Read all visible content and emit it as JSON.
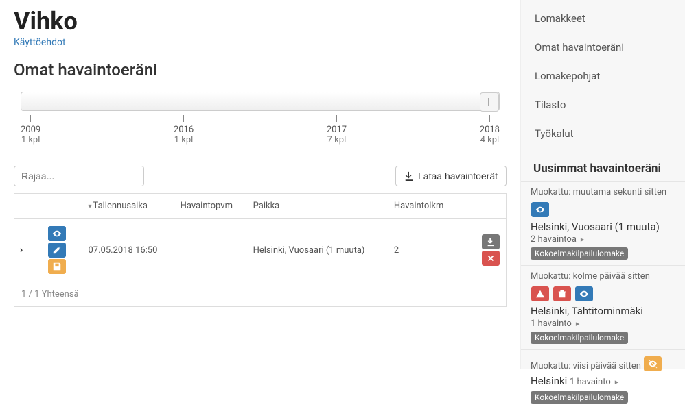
{
  "header": {
    "title": "Vihko",
    "terms": "Käyttöehdot",
    "subtitle": "Omat havaintoeräni"
  },
  "timeline": [
    {
      "year": "2009",
      "count": "1 kpl"
    },
    {
      "year": "2016",
      "count": "1 kpl"
    },
    {
      "year": "2017",
      "count": "7 kpl"
    },
    {
      "year": "2018",
      "count": "4 kpl"
    }
  ],
  "filter_placeholder": "Rajaa...",
  "download_label": "Lataa havaintoerät",
  "table": {
    "headers": {
      "saved": "Tallennusaika",
      "obsdate": "Havaintopvm",
      "place": "Paikka",
      "count": "Havaintolkm"
    },
    "rows": [
      {
        "saved": "07.05.2018 16:50",
        "obsdate": "",
        "place": "Helsinki, Vuosaari (1 muuta)",
        "count": "2"
      }
    ],
    "footer": "1 / 1 Yhteensä"
  },
  "icons": {
    "eye": "eye",
    "edit": "edit",
    "save": "save",
    "download": "download",
    "delete": "delete",
    "warn": "warn",
    "trash": "trash",
    "partial": "partial"
  },
  "sidebar": {
    "nav": [
      "Lomakkeet",
      "Omat havaintoeräni",
      "Lomakepohjat",
      "Tilasto",
      "Työkalut"
    ],
    "recent_heading": "Uusimmat havaintoeräni",
    "cards": [
      {
        "meta": "Muokattu: muutama sekunti sitten",
        "icons": [
          "eye"
        ],
        "title": "Helsinki, Vuosaari (1 muuta)",
        "sub": "2 havaintoa",
        "tag": "Kokoelmakilpailulomake"
      },
      {
        "meta": "Muokattu: kolme päivää sitten",
        "icons": [
          "warn",
          "trash",
          "eye"
        ],
        "title": "Helsinki, Tähtitorninmäki",
        "sub": "1 havainto",
        "tag": "Kokoelmakilpailulomake"
      },
      {
        "meta": "Muokattu: viisi päivää sitten",
        "meta_icon": "partial",
        "title": "Helsinki",
        "sub": "1 havainto",
        "tag": "Kokoelmakilpailulomake",
        "inline_sub": true
      }
    ]
  }
}
